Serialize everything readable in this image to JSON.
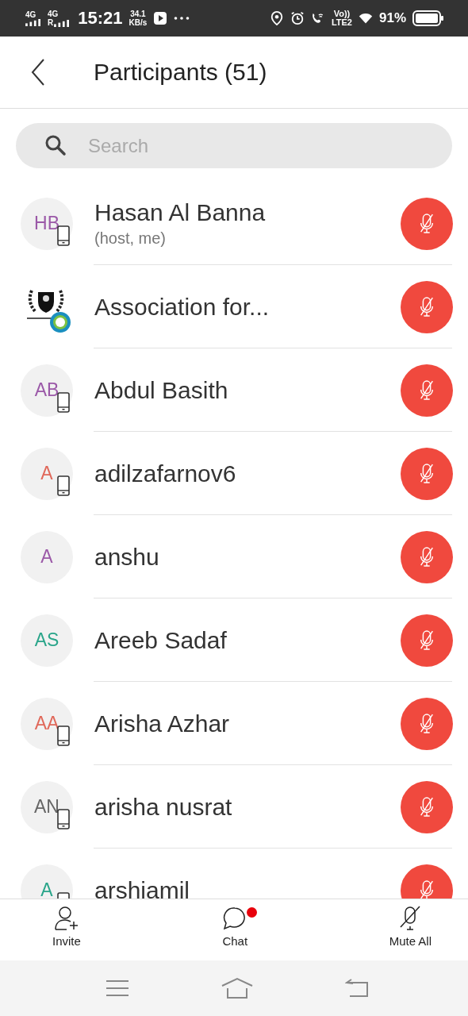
{
  "status_bar": {
    "networks": [
      {
        "label": "4G"
      },
      {
        "label": "4G",
        "roaming": "R"
      }
    ],
    "time": "15:21",
    "speed": "34.1",
    "speed_unit": "KB/s",
    "volte": "Vo))",
    "lte": "LTE2",
    "battery": "91%"
  },
  "header": {
    "title": "Participants (51)"
  },
  "search": {
    "placeholder": "Search"
  },
  "participants": [
    {
      "initials": "HB",
      "kind": "initials",
      "color": "#9b59a8",
      "name": "Hasan Al Banna",
      "subtitle": "(host, me)",
      "mobile": true,
      "muted": true
    },
    {
      "kind": "picture",
      "name": "Association for...",
      "mobile": false,
      "muted": true
    },
    {
      "initials": "AB",
      "kind": "initials",
      "color": "#9b59a8",
      "name": "Abdul Basith",
      "mobile": true,
      "muted": true
    },
    {
      "initials": "A",
      "kind": "initials",
      "color": "#e0685a",
      "name": "adilzafarnov6",
      "mobile": true,
      "muted": true
    },
    {
      "initials": "A",
      "kind": "initials",
      "color": "#9b59a8",
      "name": "anshu",
      "mobile": false,
      "muted": true
    },
    {
      "initials": "AS",
      "kind": "initials",
      "color": "#2aa58a",
      "name": "Areeb Sadaf",
      "mobile": false,
      "muted": true
    },
    {
      "initials": "AA",
      "kind": "initials",
      "color": "#e0685a",
      "name": "Arisha Azhar",
      "mobile": true,
      "muted": true
    },
    {
      "initials": "AN",
      "kind": "initials",
      "color": "#666666",
      "name": "arisha nusrat",
      "mobile": true,
      "muted": true
    },
    {
      "initials": "A",
      "kind": "initials",
      "color": "#2aa58a",
      "name": "arshiamil",
      "mobile": true,
      "muted": true
    }
  ],
  "toolbar": [
    {
      "kind": "invite",
      "label": "Invite",
      "badge": false
    },
    {
      "kind": "chat",
      "label": "Chat",
      "badge": true
    },
    {
      "kind": "mute",
      "label": "Mute All",
      "badge": false
    }
  ]
}
